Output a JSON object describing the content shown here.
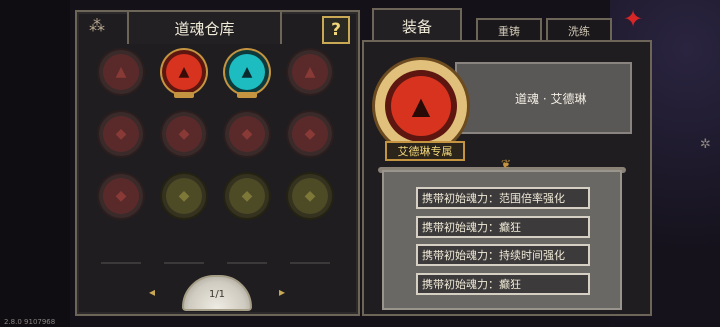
{
  "warehouse": {
    "title": "道魂仓库",
    "help_label": "?",
    "pager": {
      "prev": "◂",
      "page": "1/1",
      "next": "▸"
    }
  },
  "equipment": {
    "tabs": [
      "装备",
      "重铸",
      "洗练"
    ],
    "soul_name": "道魂 · 艾德琳",
    "exclusive_label": "艾德琳专属",
    "attributes": [
      "携带初始魂力：范围倍率强化",
      "携带初始魂力：癫狂",
      "携带初始魂力：持续时间强化",
      "携带初始魂力：癫狂"
    ]
  },
  "version": "2.8.0 9107968",
  "colors": {
    "accent_gold": "#c49440",
    "active_red": "#d7331f",
    "active_teal": "#1cbcc0"
  }
}
